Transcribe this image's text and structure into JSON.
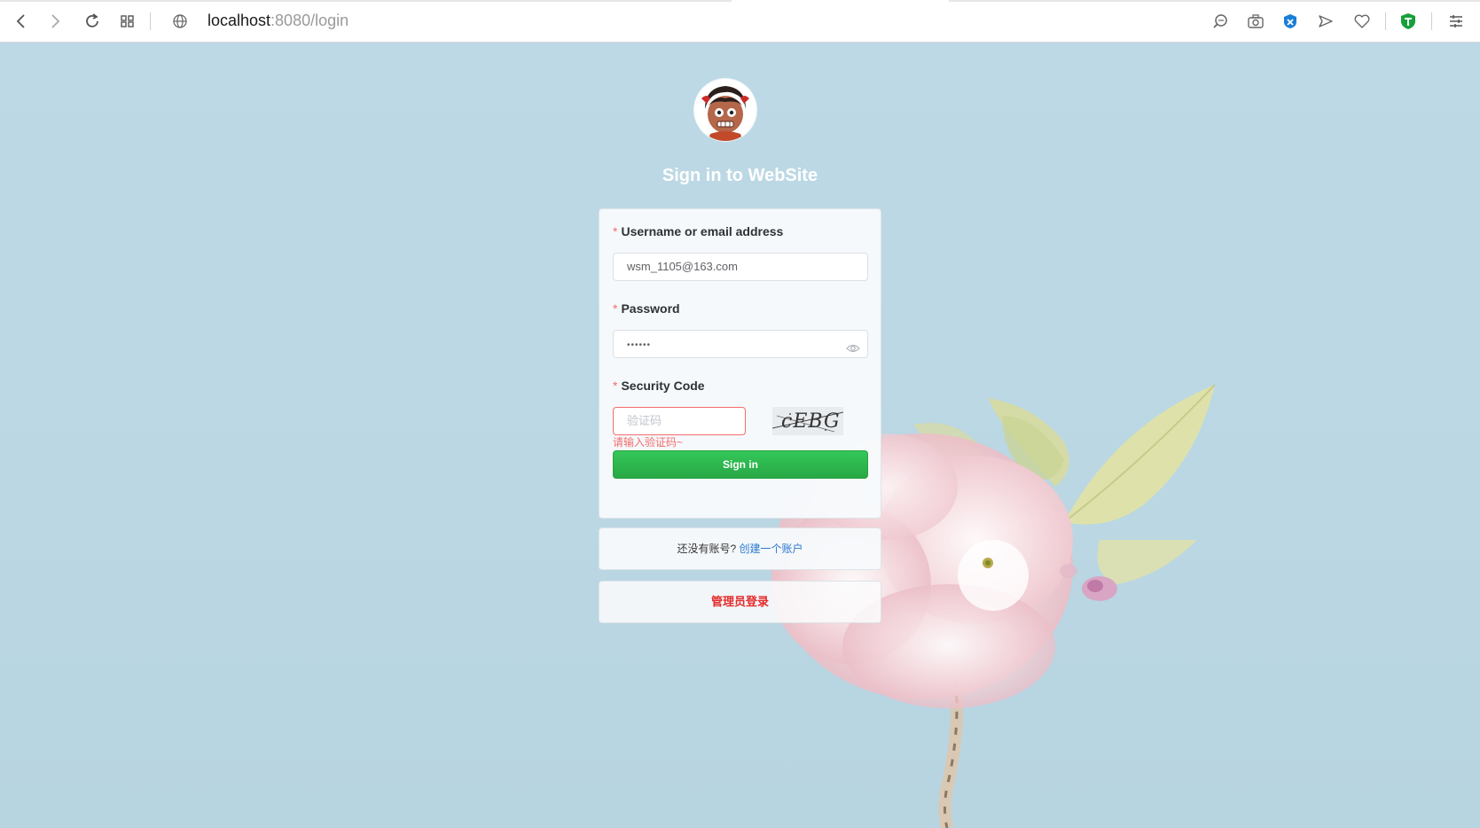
{
  "browser": {
    "url_host": "localhost",
    "url_path": ":8080/login",
    "icons": [
      "back-icon",
      "forward-icon",
      "reload-icon",
      "tabs-grid-icon",
      "globe-icon",
      "search-icon",
      "camera-icon",
      "extension-x-icon",
      "send-icon",
      "heart-icon",
      "shield-icon",
      "menu-icon"
    ]
  },
  "login": {
    "title": "Sign in to WebSite",
    "username_label": "Username or email address",
    "username_value": "wsm_1105@163.com",
    "password_label": "Password",
    "password_value": "••••••",
    "security_label": "Security Code",
    "security_placeholder": "验证码",
    "security_error": "请输入验证码~",
    "captcha_text": "cEBG",
    "signin_label": "Sign in",
    "required_mark": "*"
  },
  "register": {
    "prompt": "还没有账号?",
    "link": "创建一个账户"
  },
  "admin": {
    "label": "管理员登录"
  },
  "colors": {
    "background": "#bcd8e4",
    "primary_green": "#2dbc50",
    "error_red": "#f56c6c",
    "link_blue": "#2a7ad0",
    "admin_red": "#e32b2b"
  }
}
